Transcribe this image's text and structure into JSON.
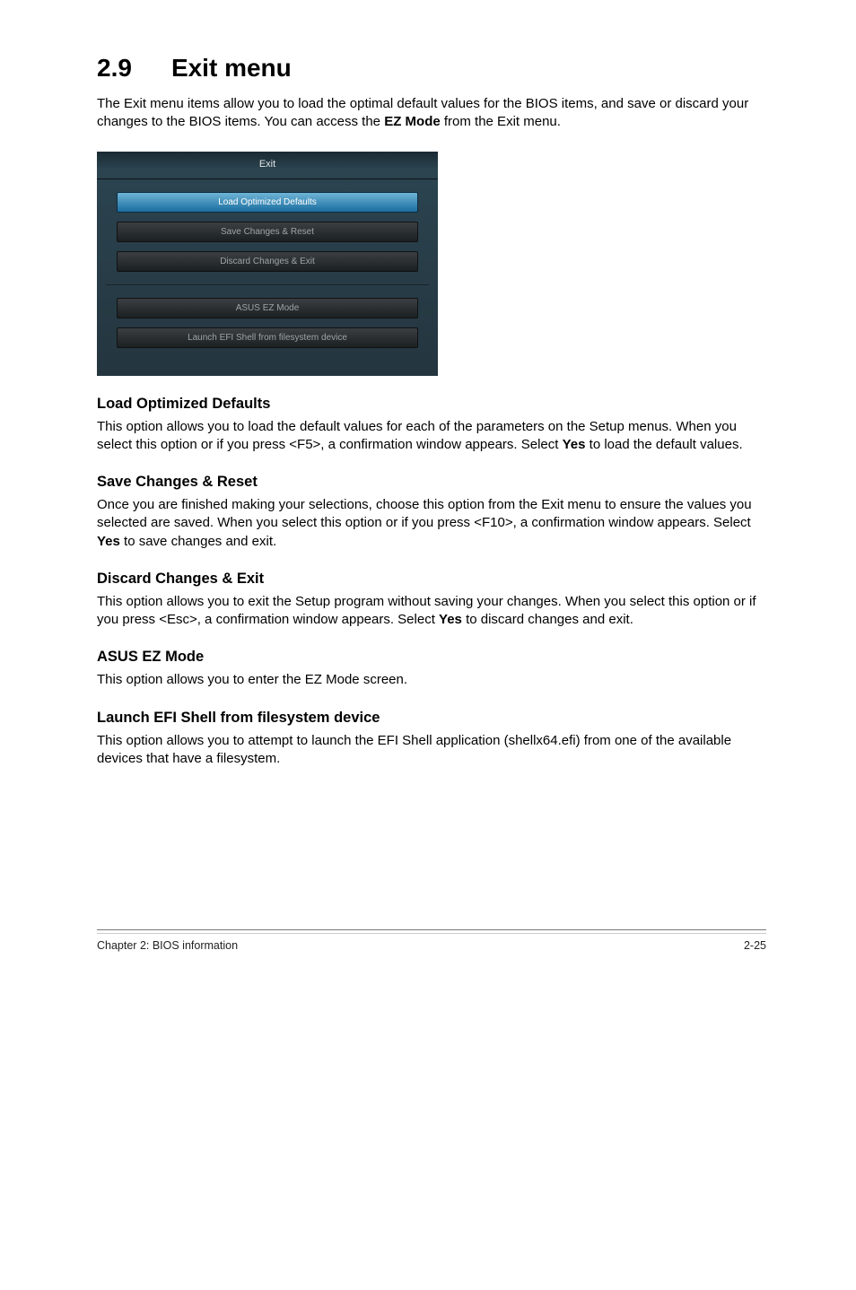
{
  "section": {
    "number": "2.9",
    "title": "Exit menu"
  },
  "intro": "The Exit menu items allow you to load the optimal default values for the BIOS items, and save or discard your changes to the BIOS items. You can access the EZ Mode from the Exit menu.",
  "panel": {
    "header": "Exit",
    "group1": [
      "Load Optimized Defaults",
      "Save Changes & Reset",
      "Discard Changes & Exit"
    ],
    "group2": [
      "ASUS EZ Mode",
      "Launch EFI Shell from filesystem device"
    ]
  },
  "sections": [
    {
      "heading": "Load Optimized Defaults",
      "body": "This option allows you to load the default values for each of the parameters on the Setup menus. When you select this option or if you press <F5>, a confirmation window appears. Select Yes to load the default values."
    },
    {
      "heading": "Save Changes & Reset",
      "body": "Once you are finished making your selections, choose this option from the Exit menu to ensure the values you selected are saved. When you select this option or if you press <F10>, a confirmation window appears. Select Yes to save changes and exit."
    },
    {
      "heading": "Discard Changes & Exit",
      "body": "This option allows you to exit the Setup program without saving your changes. When you select this option or if you press <Esc>, a confirmation window appears. Select Yes to discard changes and exit."
    },
    {
      "heading": "ASUS EZ Mode",
      "body": "This option allows you to enter the EZ Mode screen."
    },
    {
      "heading": "Launch EFI Shell from filesystem device",
      "body": "This option allows you to attempt to launch the EFI Shell application (shellx64.efi) from one of the available devices that have a filesystem."
    }
  ],
  "footer": {
    "left": "Chapter 2: BIOS information",
    "right": "2-25"
  }
}
